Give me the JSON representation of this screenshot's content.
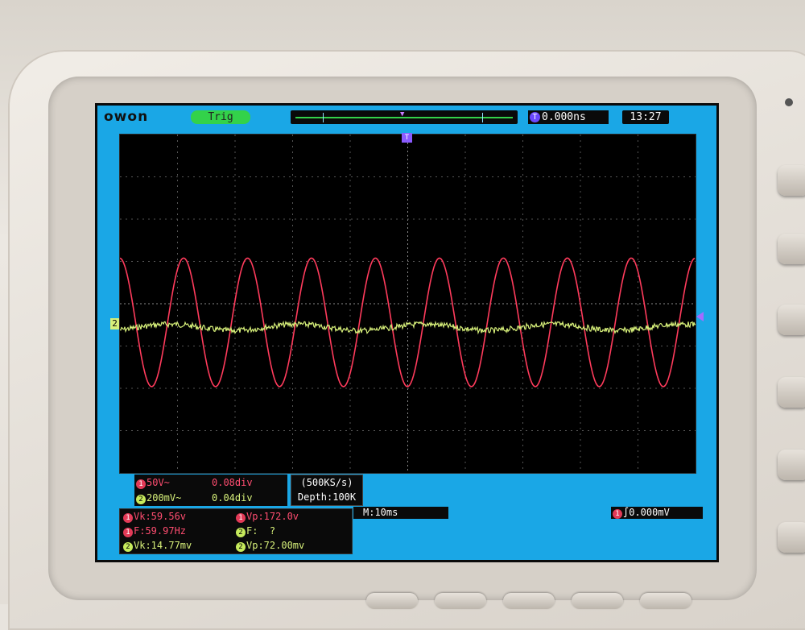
{
  "brand": "owon",
  "status": {
    "trig": "Trig"
  },
  "trigger_delay": {
    "badge": "T",
    "value": "0.000ns"
  },
  "clock": "13:27",
  "channels": [
    {
      "num": "1",
      "volts": "50V~",
      "offset": "0.08div",
      "color": "#ff4d70"
    },
    {
      "num": "2",
      "volts": "200mV~",
      "offset": "0.04div",
      "color": "#d7f07a"
    }
  ],
  "sample": {
    "rate": "(500KS/s)",
    "depth": "Depth:100K"
  },
  "timebase": "M:10ms",
  "trigger": {
    "channel": "1",
    "edge": "∫",
    "level": "0.000mV"
  },
  "measurements": [
    {
      "ch": "1",
      "label": "Vk:59.56v"
    },
    {
      "ch": "1",
      "label": "Vp:172.0v"
    },
    {
      "ch": "1",
      "label": "F:59.97Hz"
    },
    {
      "ch": "2",
      "label": "F:  ?"
    },
    {
      "ch": "2",
      "label": "Vk:14.77mv"
    },
    {
      "ch": "2",
      "label": "Vp:72.00mv"
    }
  ],
  "markers": {
    "ch2": "2",
    "trig_pos": "T"
  },
  "waveforms": {
    "ch1": {
      "color": "#ff3b5c",
      "cycles_on_screen": 9
    },
    "ch2": {
      "color": "#d7f07a"
    }
  }
}
